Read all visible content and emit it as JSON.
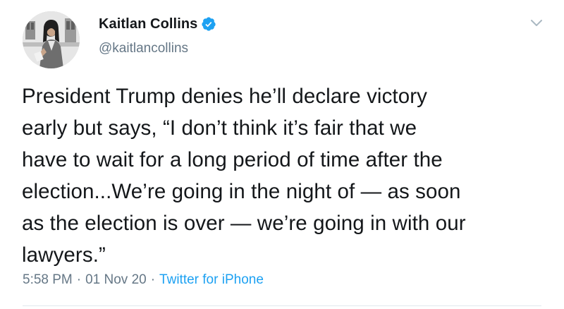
{
  "author": {
    "display_name": "Kaitlan Collins",
    "handle": "@kaitlancollins",
    "verified": true,
    "avatar_icon": "profile-photo"
  },
  "tweet": {
    "text": "President Trump denies he’ll declare victory\nearly but says, “I don’t think it’s fair that we\nhave to wait for a long period of time after the\nelection...We’re going in the night of — as soon\nas the election is over — we’re going in with our\nlawyers.”",
    "time": "5:58 PM",
    "date": "01 Nov 20",
    "separator": "·",
    "source": "Twitter for iPhone"
  },
  "icons": {
    "verified": "verified-badge-icon",
    "menu": "chevron-down-icon"
  },
  "colors": {
    "text_primary": "#14171a",
    "text_secondary": "#657786",
    "accent": "#1da1f2",
    "divider": "#e1e8ed"
  }
}
